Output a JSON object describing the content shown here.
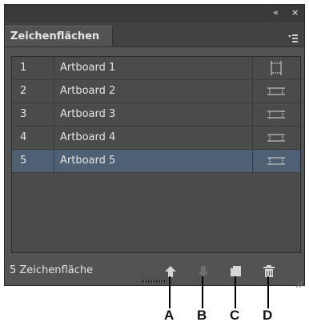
{
  "panel": {
    "collapse_glyph": "«",
    "close_glyph": "×",
    "tab_label": "Zeichenflächen",
    "menu_icon": "panel-menu-icon"
  },
  "artboards": [
    {
      "num": "1",
      "name": "Artboard 1",
      "selected": false
    },
    {
      "num": "2",
      "name": "Artboard 2",
      "selected": false
    },
    {
      "num": "3",
      "name": "Artboard 3",
      "selected": false
    },
    {
      "num": "4",
      "name": "Artboard 4",
      "selected": false
    },
    {
      "num": "5",
      "name": "Artboard 5",
      "selected": true
    }
  ],
  "footer": {
    "status": "5 Zeichenfläche",
    "buttons": [
      "move-up-icon",
      "move-down-icon",
      "new-artboard-icon",
      "delete-icon"
    ]
  },
  "callouts": [
    "A",
    "B",
    "C",
    "D"
  ],
  "colors": {
    "panel_bg": "#535353",
    "selected_row": "#4f5f74",
    "text": "#e4e4e4"
  }
}
